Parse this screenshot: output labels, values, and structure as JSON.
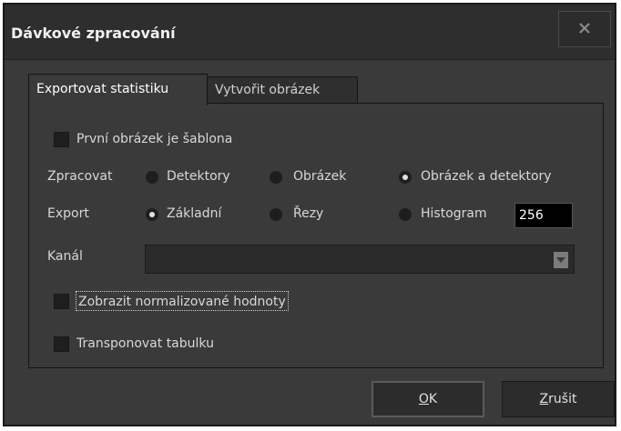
{
  "window": {
    "title": "Dávkové zpracování"
  },
  "tabs": [
    {
      "label": "Exportovat statistiku",
      "active": true
    },
    {
      "label": "Vytvořit obrázek",
      "active": false
    }
  ],
  "template_checkbox": {
    "label": "První obrázek je šablona",
    "checked": false
  },
  "process": {
    "label": "Zpracovat",
    "options": [
      "Detektory",
      "Obrázek",
      "Obrázek a detektory"
    ],
    "selected": "Obrázek a detektory"
  },
  "export": {
    "label": "Export",
    "options": [
      "Základní",
      "Řezy",
      "Histogram"
    ],
    "selected": "Základní",
    "histogram_bins": "256"
  },
  "channel": {
    "label": "Kanál",
    "value": ""
  },
  "normalized_checkbox": {
    "label": "Zobrazit normalizované hodnoty",
    "checked": false
  },
  "transpose_checkbox": {
    "label": "Transponovat tabulku",
    "checked": false
  },
  "buttons": {
    "ok_rest": "K",
    "ok_key": "O",
    "cancel_key": "Z",
    "cancel_rest": "rušit"
  },
  "icons": {
    "close": "close-icon",
    "dropdown": "chevron-down-icon"
  }
}
